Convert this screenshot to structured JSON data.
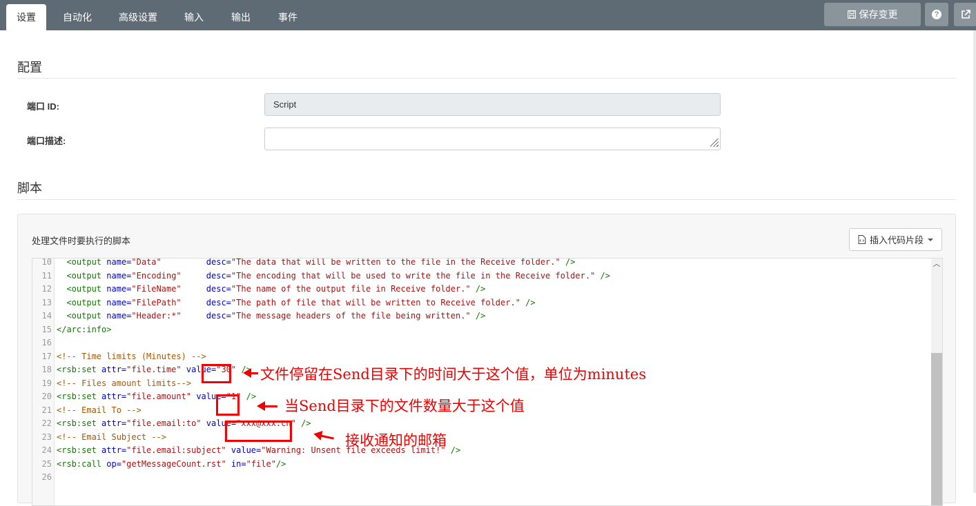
{
  "tabs": [
    {
      "label": "设置",
      "active": true
    },
    {
      "label": "自动化"
    },
    {
      "label": "高级设置"
    },
    {
      "label": "输入"
    },
    {
      "label": "输出"
    },
    {
      "label": "事件"
    }
  ],
  "toolbar": {
    "save_label": "保存变更",
    "save_icon": "floppy-disk-icon",
    "help_icon": "question-circle-icon",
    "popout_icon": "external-link-icon"
  },
  "config": {
    "title": "配置",
    "port_id_label": "端口 ID:",
    "port_id_value": "Script",
    "port_desc_label": "端口描述:",
    "port_desc_value": ""
  },
  "script": {
    "title": "脚本",
    "panel_label": "处理文件时要执行的脚本",
    "snippet_button": "插入代码片段"
  },
  "code_lines": [
    {
      "n": "10"
    },
    {
      "n": "11"
    },
    {
      "n": "12"
    },
    {
      "n": "13"
    },
    {
      "n": "14"
    },
    {
      "n": "15"
    },
    {
      "n": "16"
    },
    {
      "n": "17"
    },
    {
      "n": "18"
    },
    {
      "n": "19"
    },
    {
      "n": "20"
    },
    {
      "n": "21"
    },
    {
      "n": "22"
    },
    {
      "n": "23"
    },
    {
      "n": "24"
    },
    {
      "n": "25"
    },
    {
      "n": "26"
    }
  ],
  "code": {
    "l10": {
      "name": "\"Data\"",
      "desc": "\"The data that will be written to the file in the Receive folder.\""
    },
    "l11": {
      "name": "\"Encoding\"",
      "desc": "\"The encoding that will be used to write the file in the Receive folder.\""
    },
    "l12": {
      "name": "\"FileName\"",
      "desc": "\"The name of the output file in Receive folder.\""
    },
    "l13": {
      "name": "\"FilePath\"",
      "desc": "\"The path of file that will be written to Receive folder.\""
    },
    "l14": {
      "name": "\"Header:*\"",
      "desc": "\"The message headers of the file being written.\""
    },
    "l17": "<!-- Time limits (Minutes) -->",
    "l18": {
      "attr": "\"file.time\"",
      "value": "\"30\""
    },
    "l19": "<!-- Files amount limits-->",
    "l20": {
      "attr": "\"file.amount\"",
      "value": "\"1\""
    },
    "l21": "<!-- Email To -->",
    "l22": {
      "attr": "\"file.email:to\"",
      "value": "\"xxx@xxx.cn\""
    },
    "l23": "<!-- Email Subject -->",
    "l24": {
      "attr": "\"file.email:subject\"",
      "value": "\"Warning: Unsent file exceeds limit!\""
    },
    "l25": {
      "op": "\"getMessageCount.rst\"",
      "in": "\"file\""
    }
  },
  "annotations": {
    "time": "文件停留在Send目录下的时间大于这个值，单位为minutes",
    "amount": "当Send目录下的文件数量大于这个值",
    "email": "接收通知的邮箱"
  }
}
